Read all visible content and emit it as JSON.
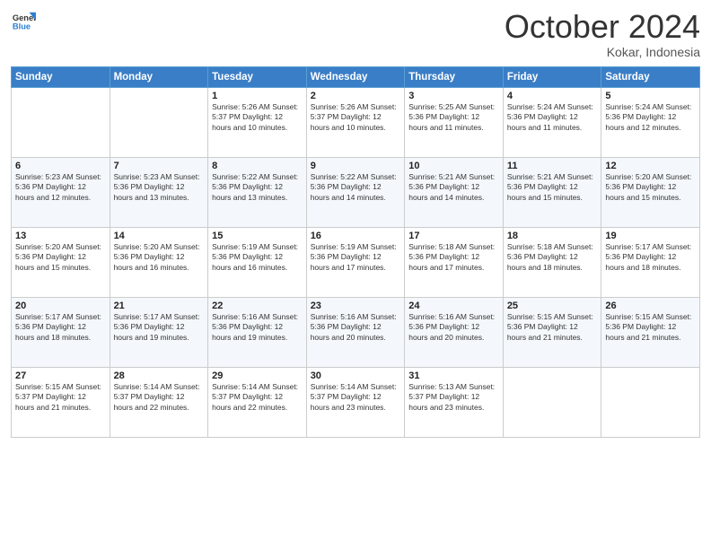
{
  "header": {
    "logo_general": "General",
    "logo_blue": "Blue",
    "month_title": "October 2024",
    "subtitle": "Kokar, Indonesia"
  },
  "days_of_week": [
    "Sunday",
    "Monday",
    "Tuesday",
    "Wednesday",
    "Thursday",
    "Friday",
    "Saturday"
  ],
  "weeks": [
    [
      {
        "day": "",
        "info": ""
      },
      {
        "day": "",
        "info": ""
      },
      {
        "day": "1",
        "info": "Sunrise: 5:26 AM\nSunset: 5:37 PM\nDaylight: 12 hours and 10 minutes."
      },
      {
        "day": "2",
        "info": "Sunrise: 5:26 AM\nSunset: 5:37 PM\nDaylight: 12 hours and 10 minutes."
      },
      {
        "day": "3",
        "info": "Sunrise: 5:25 AM\nSunset: 5:36 PM\nDaylight: 12 hours and 11 minutes."
      },
      {
        "day": "4",
        "info": "Sunrise: 5:24 AM\nSunset: 5:36 PM\nDaylight: 12 hours and 11 minutes."
      },
      {
        "day": "5",
        "info": "Sunrise: 5:24 AM\nSunset: 5:36 PM\nDaylight: 12 hours and 12 minutes."
      }
    ],
    [
      {
        "day": "6",
        "info": "Sunrise: 5:23 AM\nSunset: 5:36 PM\nDaylight: 12 hours and 12 minutes."
      },
      {
        "day": "7",
        "info": "Sunrise: 5:23 AM\nSunset: 5:36 PM\nDaylight: 12 hours and 13 minutes."
      },
      {
        "day": "8",
        "info": "Sunrise: 5:22 AM\nSunset: 5:36 PM\nDaylight: 12 hours and 13 minutes."
      },
      {
        "day": "9",
        "info": "Sunrise: 5:22 AM\nSunset: 5:36 PM\nDaylight: 12 hours and 14 minutes."
      },
      {
        "day": "10",
        "info": "Sunrise: 5:21 AM\nSunset: 5:36 PM\nDaylight: 12 hours and 14 minutes."
      },
      {
        "day": "11",
        "info": "Sunrise: 5:21 AM\nSunset: 5:36 PM\nDaylight: 12 hours and 15 minutes."
      },
      {
        "day": "12",
        "info": "Sunrise: 5:20 AM\nSunset: 5:36 PM\nDaylight: 12 hours and 15 minutes."
      }
    ],
    [
      {
        "day": "13",
        "info": "Sunrise: 5:20 AM\nSunset: 5:36 PM\nDaylight: 12 hours and 15 minutes."
      },
      {
        "day": "14",
        "info": "Sunrise: 5:20 AM\nSunset: 5:36 PM\nDaylight: 12 hours and 16 minutes."
      },
      {
        "day": "15",
        "info": "Sunrise: 5:19 AM\nSunset: 5:36 PM\nDaylight: 12 hours and 16 minutes."
      },
      {
        "day": "16",
        "info": "Sunrise: 5:19 AM\nSunset: 5:36 PM\nDaylight: 12 hours and 17 minutes."
      },
      {
        "day": "17",
        "info": "Sunrise: 5:18 AM\nSunset: 5:36 PM\nDaylight: 12 hours and 17 minutes."
      },
      {
        "day": "18",
        "info": "Sunrise: 5:18 AM\nSunset: 5:36 PM\nDaylight: 12 hours and 18 minutes."
      },
      {
        "day": "19",
        "info": "Sunrise: 5:17 AM\nSunset: 5:36 PM\nDaylight: 12 hours and 18 minutes."
      }
    ],
    [
      {
        "day": "20",
        "info": "Sunrise: 5:17 AM\nSunset: 5:36 PM\nDaylight: 12 hours and 18 minutes."
      },
      {
        "day": "21",
        "info": "Sunrise: 5:17 AM\nSunset: 5:36 PM\nDaylight: 12 hours and 19 minutes."
      },
      {
        "day": "22",
        "info": "Sunrise: 5:16 AM\nSunset: 5:36 PM\nDaylight: 12 hours and 19 minutes."
      },
      {
        "day": "23",
        "info": "Sunrise: 5:16 AM\nSunset: 5:36 PM\nDaylight: 12 hours and 20 minutes."
      },
      {
        "day": "24",
        "info": "Sunrise: 5:16 AM\nSunset: 5:36 PM\nDaylight: 12 hours and 20 minutes."
      },
      {
        "day": "25",
        "info": "Sunrise: 5:15 AM\nSunset: 5:36 PM\nDaylight: 12 hours and 21 minutes."
      },
      {
        "day": "26",
        "info": "Sunrise: 5:15 AM\nSunset: 5:36 PM\nDaylight: 12 hours and 21 minutes."
      }
    ],
    [
      {
        "day": "27",
        "info": "Sunrise: 5:15 AM\nSunset: 5:37 PM\nDaylight: 12 hours and 21 minutes."
      },
      {
        "day": "28",
        "info": "Sunrise: 5:14 AM\nSunset: 5:37 PM\nDaylight: 12 hours and 22 minutes."
      },
      {
        "day": "29",
        "info": "Sunrise: 5:14 AM\nSunset: 5:37 PM\nDaylight: 12 hours and 22 minutes."
      },
      {
        "day": "30",
        "info": "Sunrise: 5:14 AM\nSunset: 5:37 PM\nDaylight: 12 hours and 23 minutes."
      },
      {
        "day": "31",
        "info": "Sunrise: 5:13 AM\nSunset: 5:37 PM\nDaylight: 12 hours and 23 minutes."
      },
      {
        "day": "",
        "info": ""
      },
      {
        "day": "",
        "info": ""
      }
    ]
  ]
}
